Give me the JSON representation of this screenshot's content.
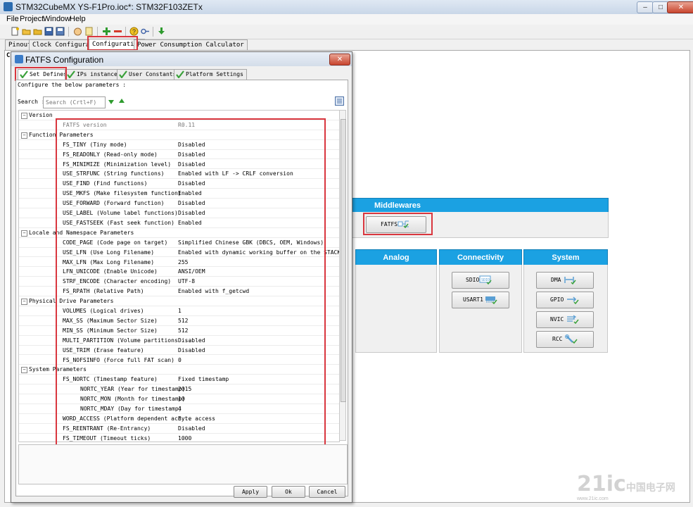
{
  "window": {
    "title": "STM32CubeMX YS-F1Pro.ioc*: STM32F103ZETx"
  },
  "menu": [
    "File",
    "Project",
    "Window",
    "Help"
  ],
  "main_tabs": [
    "Pinout",
    "Clock Configuration",
    "Configuration",
    "Power Consumption Calculator"
  ],
  "stub_left": "C",
  "dialog": {
    "title": "FATFS Configuration",
    "tabs": [
      "Set Defines",
      "IPs instances",
      "User Constants",
      "Platform Settings"
    ],
    "instruction": "Configure the below parameters :",
    "search_label": "Search :",
    "search_placeholder": "Search (Crtl+F)",
    "buttons": {
      "apply": "Apply",
      "ok": "Ok",
      "cancel": "Cancel"
    }
  },
  "tree": [
    {
      "type": "group",
      "label": "Version"
    },
    {
      "type": "param",
      "name": "FATFS version",
      "value": "R0.11",
      "dim": true
    },
    {
      "type": "group",
      "label": "Function Parameters"
    },
    {
      "type": "param",
      "name": "FS_TINY (Tiny mode)",
      "value": "Disabled"
    },
    {
      "type": "param",
      "name": "FS_READONLY (Read-only mode)",
      "value": "Disabled"
    },
    {
      "type": "param",
      "name": "FS_MINIMIZE (Minimization level)",
      "value": "Disabled"
    },
    {
      "type": "param",
      "name": "USE_STRFUNC (String functions)",
      "value": "Enabled with LF -> CRLF conversion"
    },
    {
      "type": "param",
      "name": "USE_FIND (Find functions)",
      "value": "Disabled"
    },
    {
      "type": "param",
      "name": "USE_MKFS (Make filesystem function)",
      "value": "Enabled"
    },
    {
      "type": "param",
      "name": "USE_FORWARD (Forward function)",
      "value": "Disabled"
    },
    {
      "type": "param",
      "name": "USE_LABEL (Volume label functions)",
      "value": "Disabled"
    },
    {
      "type": "param",
      "name": "USE_FASTSEEK (Fast seek function)",
      "value": "Enabled"
    },
    {
      "type": "group",
      "label": "Locale and Namespace Parameters"
    },
    {
      "type": "param",
      "name": "CODE_PAGE (Code page on target)",
      "value": "Simplified Chinese GBK (DBCS, OEM, Windows)"
    },
    {
      "type": "param",
      "name": "USE_LFN (Use Long Filename)",
      "value": "Enabled with dynamic working buffer on the STACK"
    },
    {
      "type": "param",
      "name": "MAX_LFN (Max Long Filename)",
      "value": "255"
    },
    {
      "type": "param",
      "name": "LFN_UNICODE (Enable Unicode)",
      "value": "ANSI/OEM"
    },
    {
      "type": "param",
      "name": "STRF_ENCODE (Character encoding)",
      "value": "UTF-8"
    },
    {
      "type": "param",
      "name": "FS_RPATH (Relative Path)",
      "value": "Enabled with f_getcwd"
    },
    {
      "type": "group",
      "label": "Physical Drive Parameters"
    },
    {
      "type": "param",
      "name": "VOLUMES (Logical drives)",
      "value": "1"
    },
    {
      "type": "param",
      "name": "MAX_SS (Maximum Sector Size)",
      "value": "512"
    },
    {
      "type": "param",
      "name": "MIN_SS (Minimum Sector Size)",
      "value": "512"
    },
    {
      "type": "param",
      "name": "MULTI_PARTITION (Volume partitions ...",
      "value": "Disabled"
    },
    {
      "type": "param",
      "name": "USE_TRIM (Erase feature)",
      "value": "Disabled"
    },
    {
      "type": "param",
      "name": "FS_NOFSINFO (Force full FAT scan)",
      "value": "0"
    },
    {
      "type": "group",
      "label": "System Parameters"
    },
    {
      "type": "param",
      "name": "FS_NORTC (Timestamp feature)",
      "value": "Fixed timestamp"
    },
    {
      "type": "param",
      "name": "NORTC_YEAR (Year for timestamp)",
      "value": "2015",
      "indent": true
    },
    {
      "type": "param",
      "name": "NORTC_MON (Month for timestamp)",
      "value": "10",
      "indent": true
    },
    {
      "type": "param",
      "name": "NORTC_MDAY (Day for timestamp)",
      "value": "4",
      "indent": true
    },
    {
      "type": "param",
      "name": "WORD_ACCESS (Platform dependent acc...",
      "value": "Byte access"
    },
    {
      "type": "param",
      "name": "FS_REENTRANT (Re-Entrancy)",
      "value": "Disabled"
    },
    {
      "type": "param",
      "name": "FS_TIMEOUT (Timeout ticks)",
      "value": "1000"
    }
  ],
  "right_panel": {
    "middlewares_header": "Middlewares",
    "fatfs_chip": "FATFS",
    "categories": [
      "Analog",
      "Connectivity",
      "System"
    ],
    "connectivity_chips": [
      "SDIO",
      "USART1"
    ],
    "system_chips": [
      "DMA",
      "GPIO",
      "NVIC",
      "RCC"
    ],
    "sdio_icon_text": "SDIO"
  },
  "watermark": {
    "main": "21ic",
    "cn": "中国电子网",
    "url": "www.21ic.com"
  },
  "colors": {
    "accent": "#1ba1e2",
    "highlight_box": "#d9363e",
    "check": "#3aa13a"
  }
}
